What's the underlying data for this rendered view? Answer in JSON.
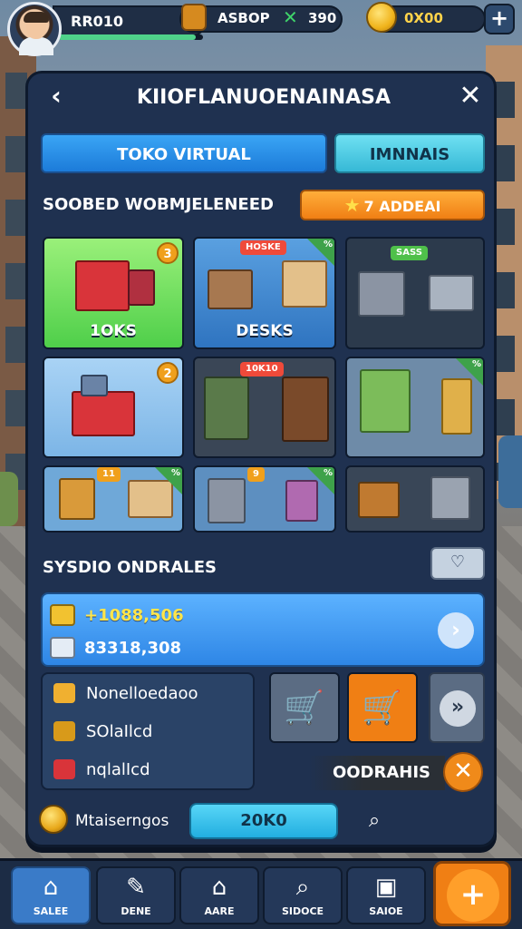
{
  "player": {
    "name": "RR010",
    "xp_fraction": 0.95
  },
  "resources": {
    "stock": "ASBOP",
    "gems": "390",
    "coins": "0X00",
    "plus": "+"
  },
  "panel": {
    "title": "KIIOFLANUOENAINASA",
    "back": "‹",
    "close": "✕",
    "tabs": [
      {
        "label": "TOKO VIRTUAL"
      },
      {
        "label": "IMNNAIS"
      }
    ],
    "section_title": "SOOBED WOBMJELENEED",
    "section_action": "7 ADDEAI",
    "tiles": [
      {
        "label": "1OKS",
        "badge": "3"
      },
      {
        "label": "DESKS",
        "tag": "HOSKE",
        "corner": "%"
      },
      {
        "label": "",
        "tag": "SASS"
      },
      {
        "label": "",
        "badge": "2"
      },
      {
        "label": "",
        "tag": "10K10"
      },
      {
        "label": "",
        "corner": "%"
      },
      {
        "label": "",
        "tag": "11",
        "corner": "%"
      },
      {
        "label": "",
        "tag": "9",
        "corner": "%"
      },
      {
        "label": ""
      }
    ],
    "subsection_title": "SYSDIO ONDRALES",
    "toggle_icon": "♡",
    "summary": {
      "line1": "+1088,506",
      "line2": "83318,308",
      "arrow": "›"
    },
    "list": [
      "Nonelloedaoo",
      "SOlaIlcd",
      "nqlalIcd"
    ],
    "next": "»",
    "orders_label": "OODRAHIS",
    "orders_close": "✕",
    "footer": {
      "label": "Mtaiserngos",
      "button": "20K0",
      "search": "⌕"
    }
  },
  "nav": [
    {
      "label": "SALEE",
      "icon": "⌂",
      "active": true
    },
    {
      "label": "DENE",
      "icon": "✎",
      "active": false
    },
    {
      "label": "AARE",
      "icon": "⌂",
      "active": false
    },
    {
      "label": "SIDOCE",
      "icon": "⌕",
      "active": false
    },
    {
      "label": "SAIOE",
      "icon": "▣",
      "active": false
    }
  ],
  "nav_plus": "+"
}
